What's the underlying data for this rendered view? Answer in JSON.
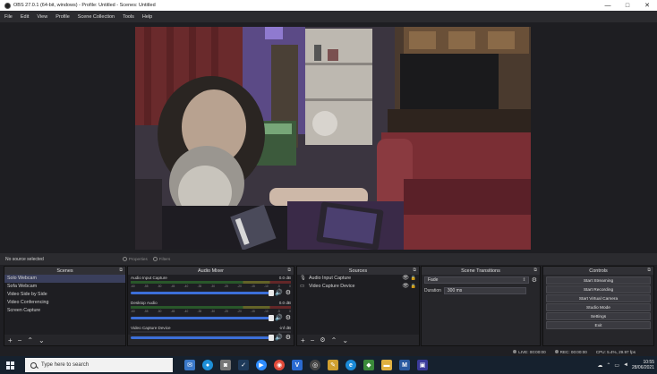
{
  "window": {
    "title": "OBS 27.0.1 (64-bit, windows) - Profile: Untitled - Scenes: Untitled",
    "controls": [
      "—",
      "□",
      "✕"
    ]
  },
  "menu": [
    "File",
    "Edit",
    "View",
    "Profile",
    "Scene Collection",
    "Tools",
    "Help"
  ],
  "source_toolbar": {
    "status": "No source selected",
    "properties": "Properties",
    "filters": "Filters"
  },
  "scenes": {
    "title": "Scenes",
    "items": [
      "Solo Webcam",
      "Sofa Webcam",
      "Video Side by Side",
      "Video Conferencing",
      "Screen Capture"
    ],
    "active_index": 0
  },
  "audio_mixer": {
    "title": "Audio Mixer",
    "ticks": [
      "-60",
      "-55",
      "-50",
      "-45",
      "-40",
      "-35",
      "-30",
      "-25",
      "-20",
      "-15",
      "-10",
      "-5",
      "0"
    ],
    "channels": [
      {
        "name": "Audio Input Capture",
        "level": "0.0 dB",
        "volume": 0.97
      },
      {
        "name": "Desktop Audio",
        "level": "0.0 dB",
        "volume": 0.97
      },
      {
        "name": "Video Capture Device",
        "level": "-inf dB",
        "volume": 0.97
      }
    ]
  },
  "sources": {
    "title": "Sources",
    "items": [
      {
        "name": "Audio Input Capture",
        "icon": "microphone-icon"
      },
      {
        "name": "Video Capture Device",
        "icon": "camera-icon"
      }
    ]
  },
  "transitions": {
    "title": "Scene Transitions",
    "selected": "Fade",
    "duration_label": "Duration",
    "duration_value": "300 ms"
  },
  "controls": {
    "title": "Controls",
    "buttons": [
      "Start Streaming",
      "Start Recording",
      "Start Virtual Camera",
      "Studio Mode",
      "Settings",
      "Exit"
    ]
  },
  "status": {
    "live": "LIVE: 00:00:00",
    "rec": "REC: 00:00:00",
    "cpu": "CPU: 5.4%, 29.97 fps"
  },
  "taskbar": {
    "search_placeholder": "Type here to search",
    "time": "10:55",
    "date": "28/06/2021"
  }
}
